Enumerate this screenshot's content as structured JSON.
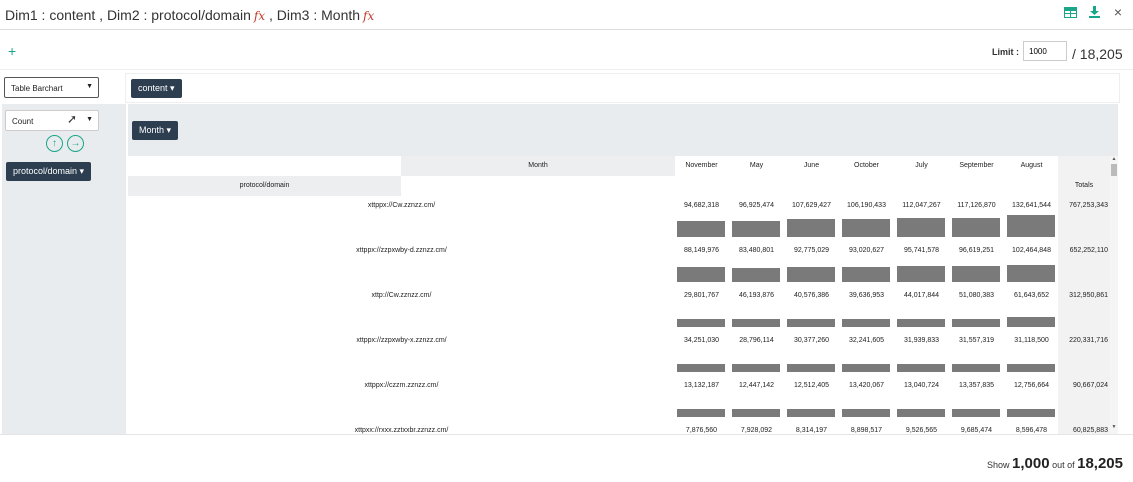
{
  "title": {
    "dim1": "Dim1 : content",
    "dim2": "Dim2 : protocol/domain",
    "dim3": "Dim3 : Month",
    "fx": "fx"
  },
  "icons": [
    "table-icon",
    "download-icon",
    "close-icon"
  ],
  "toolbar": {
    "add_label": "+",
    "limit_label": "Limit :",
    "limit_value": "1000",
    "total": "/ 18,205"
  },
  "renderer": {
    "selected": "Table Barchart"
  },
  "aggregator": {
    "selected": "Count"
  },
  "pills": {
    "content": "content",
    "month": "Month",
    "protocol_domain": "protocol/domain"
  },
  "table": {
    "month_header": "Month",
    "row_header": "protocol/domain",
    "totals_header": "Totals",
    "months": [
      "November",
      "May",
      "June",
      "October",
      "July",
      "September",
      "August"
    ],
    "rows": [
      {
        "label": "xttppx://Cw.zznzz.cm/",
        "values": [
          "94,682,318",
          "96,925,474",
          "107,629,427",
          "106,190,433",
          "112,047,267",
          "117,126,870",
          "132,641,544"
        ],
        "nums": [
          94682318,
          96925474,
          107629427,
          106190433,
          112047267,
          117126870,
          132641544
        ],
        "total": "767,253,343"
      },
      {
        "label": "xttppx://zzpxwby-d.zznzz.cm/",
        "values": [
          "88,149,976",
          "83,480,801",
          "92,775,029",
          "93,020,627",
          "95,741,578",
          "96,619,251",
          "102,464,848"
        ],
        "nums": [
          88149976,
          83480801,
          92775029,
          93020627,
          95741578,
          96619251,
          102464848
        ],
        "total": "652,252,110"
      },
      {
        "label": "xttp://Cw.zznzz.cm/",
        "values": [
          "29,801,767",
          "46,193,876",
          "40,576,386",
          "39,636,953",
          "44,017,844",
          "51,080,383",
          "61,643,652"
        ],
        "nums": [
          29801767,
          46193876,
          40576386,
          39636953,
          44017844,
          51080383,
          61643652
        ],
        "total": "312,950,861"
      },
      {
        "label": "xttppx://zzpxwby-x.zznzz.cm/",
        "values": [
          "34,251,030",
          "28,796,114",
          "30,377,260",
          "32,241,605",
          "31,939,833",
          "31,557,319",
          "31,118,500"
        ],
        "nums": [
          34251030,
          28796114,
          30377260,
          32241605,
          31939833,
          31557319,
          31118500
        ],
        "total": "220,331,716"
      },
      {
        "label": "xttppx://czzm.zznzz.cm/",
        "values": [
          "13,132,187",
          "12,447,142",
          "12,512,405",
          "13,420,067",
          "13,040,724",
          "13,357,835",
          "12,756,664"
        ],
        "nums": [
          13132187,
          12447142,
          12512405,
          13420067,
          13040724,
          13357835,
          12756664
        ],
        "total": "90,667,024"
      },
      {
        "label": "xttpxx://rxxx.zztxxbr.zznzz.cm/",
        "values": [
          "7,876,560",
          "7,928,092",
          "8,314,197",
          "8,898,517",
          "9,526,565",
          "9,685,474",
          "8,596,478"
        ],
        "nums": [
          7876560,
          7928092,
          8314197,
          8898517,
          9526565,
          9685474,
          8596478
        ],
        "total": "60,825,883"
      }
    ]
  },
  "footer": {
    "show": "Show",
    "shown": "1,000",
    "out_of": "out of",
    "total": "18,205"
  }
}
